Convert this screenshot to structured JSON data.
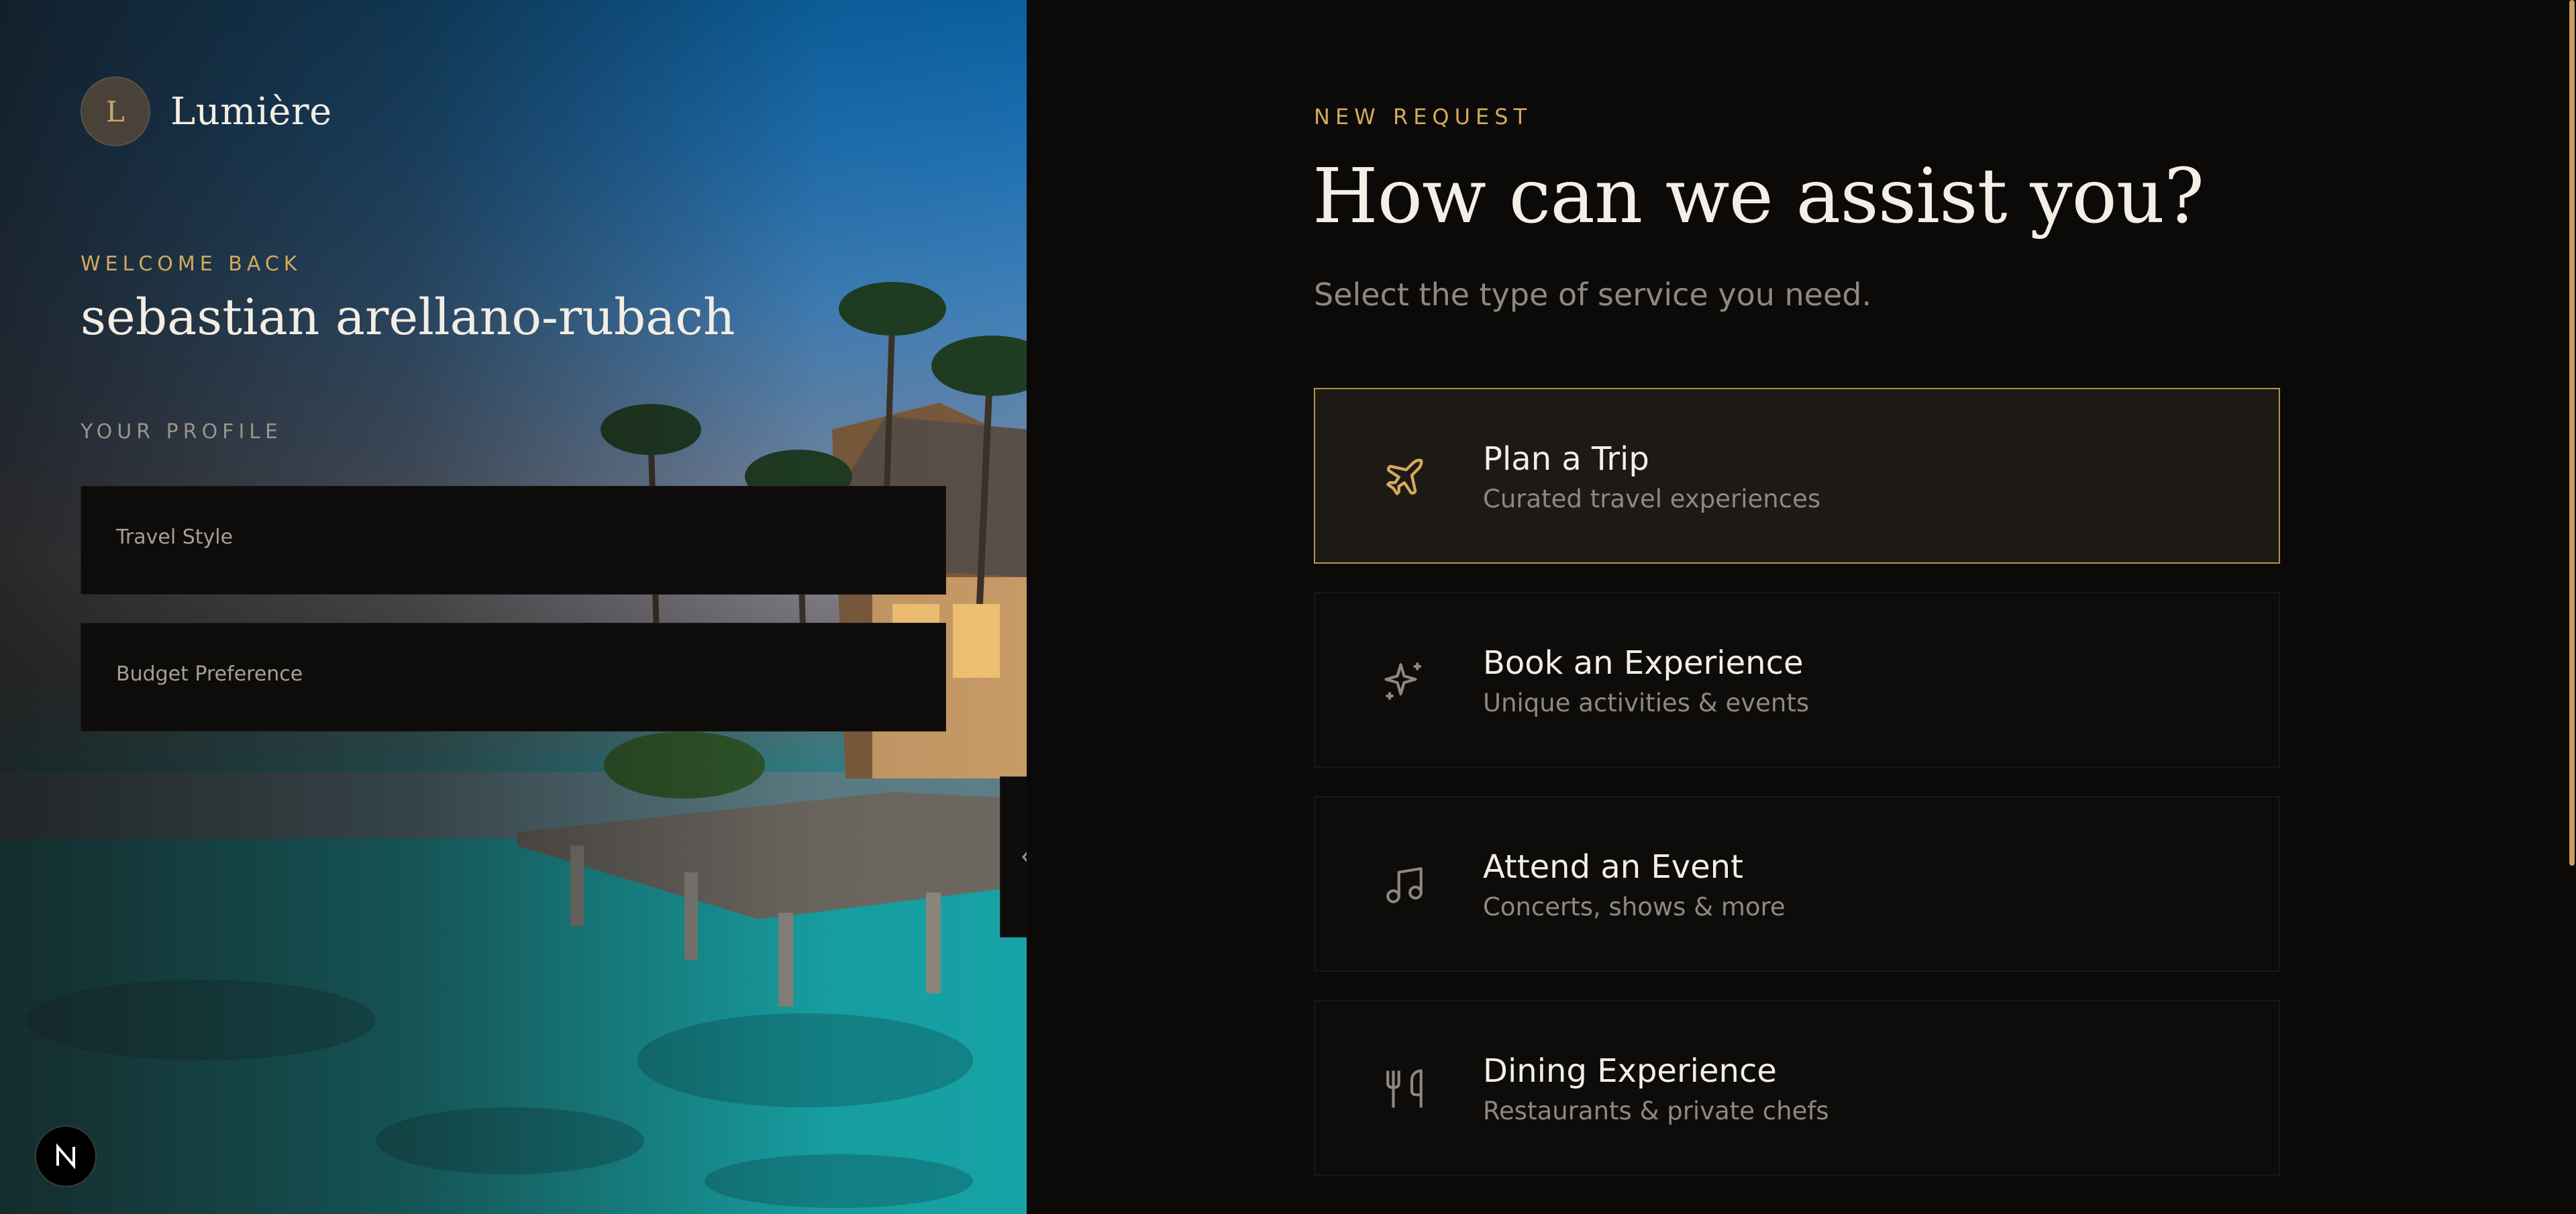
{
  "brand": {
    "initial": "L",
    "name": "Lumière"
  },
  "profile": {
    "welcome_label": "WELCOME BACK",
    "user_name": "sebastian arellano-rubach",
    "section_label": "YOUR PROFILE",
    "fields": [
      {
        "label": "Travel Style"
      },
      {
        "label": "Budget Preference"
      }
    ]
  },
  "request": {
    "eyebrow": "NEW REQUEST",
    "title": "How can we assist you?",
    "subtitle": "Select the type of service you need.",
    "options": [
      {
        "title": "Plan a Trip",
        "description": "Curated travel experiences",
        "icon": "plane-icon",
        "selected": true
      },
      {
        "title": "Book an Experience",
        "description": "Unique activities & events",
        "icon": "sparkle-icon",
        "selected": false
      },
      {
        "title": "Attend an Event",
        "description": "Concerts, shows & more",
        "icon": "music-note-icon",
        "selected": false
      },
      {
        "title": "Dining Experience",
        "description": "Restaurants & private chefs",
        "icon": "utensils-icon",
        "selected": false
      }
    ]
  },
  "badge": {
    "letter": "N"
  },
  "colors": {
    "accent": "#d4a95e",
    "background": "#0b0a09",
    "card_selected_border": "#b69252"
  }
}
